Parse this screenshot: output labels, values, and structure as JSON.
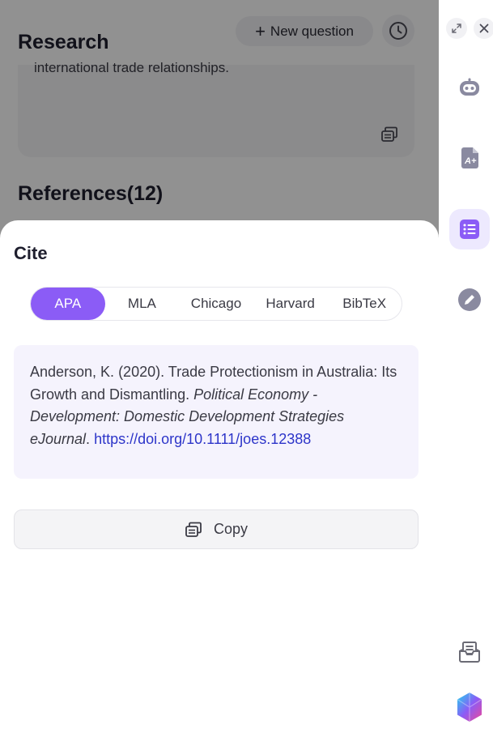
{
  "header": {
    "research_title": "Research",
    "new_question_label": "New question",
    "answer_excerpt": "international trade relationships.",
    "references_title": "References(12)"
  },
  "cite_sheet": {
    "title": "Cite",
    "styles": [
      {
        "label": "APA",
        "active": true
      },
      {
        "label": "MLA",
        "active": false
      },
      {
        "label": "Chicago",
        "active": false
      },
      {
        "label": "Harvard",
        "active": false
      },
      {
        "label": "BibTeX",
        "active": false
      }
    ],
    "citation": {
      "authors_text": "Anderson, K. (2020). Trade Protectionism in Australia: Its Growth and Dismantling.",
      "journal": "Political Economy - Development: Domestic Development Strategies eJournal",
      "doi_url": "https://doi.org/10.1111/joes.12388"
    },
    "copy_label": "Copy"
  },
  "sidebar": {
    "items": [
      {
        "name": "chat-bot",
        "icon": "bot-icon",
        "active": false
      },
      {
        "name": "ai-writer",
        "icon": "document-ai-icon",
        "active": false
      },
      {
        "name": "references",
        "icon": "list-icon",
        "active": true
      },
      {
        "name": "edit",
        "icon": "pencil-icon",
        "active": false
      }
    ],
    "bottom": [
      {
        "name": "inbox",
        "icon": "inbox-icon"
      },
      {
        "name": "app-logo",
        "icon": "gem-logo-icon"
      }
    ]
  },
  "colors": {
    "accent": "#8b5cf6",
    "accent_light": "#ede9fe",
    "citation_bg": "#f5f3fd",
    "link": "#2d35c9"
  }
}
